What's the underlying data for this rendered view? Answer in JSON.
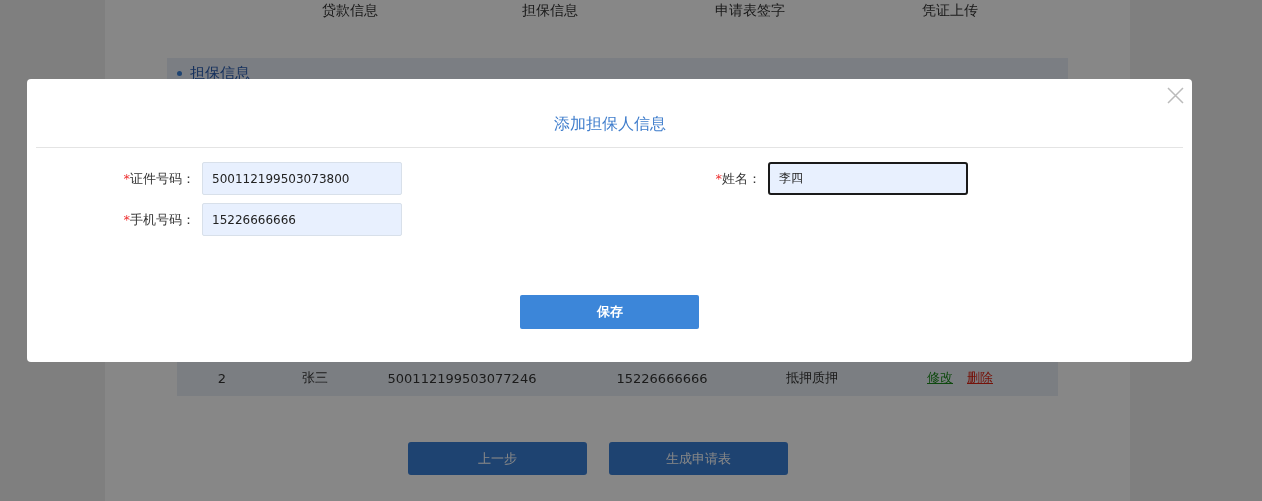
{
  "steps": [
    "贷款信息",
    "担保信息",
    "申请表签字",
    "凭证上传"
  ],
  "section": {
    "title": "担保信息"
  },
  "table": {
    "rows": [
      {
        "cells": [
          "2",
          "张三",
          "500112199503077246",
          "15226666666",
          "抵押质押"
        ],
        "actions": [
          {
            "label": "修改",
            "kind": "edit"
          },
          {
            "label": "删除",
            "kind": "delete"
          }
        ]
      }
    ]
  },
  "buttons": [
    "上一步",
    "生成申请表"
  ],
  "dialog": {
    "title": "添加担保人信息",
    "fields": [
      {
        "label": "证件号码：",
        "mark": "*",
        "value": "500112199503073800",
        "focused": false
      },
      {
        "label": "姓名：",
        "mark": "*",
        "value": "李四",
        "focused": true
      },
      {
        "label": "手机号码：",
        "mark": "*",
        "value": "15226666666",
        "focused": false
      }
    ],
    "save": "保存"
  }
}
